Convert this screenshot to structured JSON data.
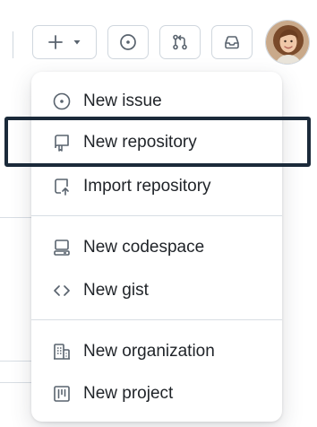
{
  "header": {
    "create_button_icon": "plus-icon",
    "create_dropdown_icon": "triangle-down-icon",
    "issues_icon": "issue-opened-icon",
    "pull_requests_icon": "git-pull-request-icon",
    "inbox_icon": "inbox-icon"
  },
  "menu": {
    "items": [
      {
        "label": "New issue",
        "icon": "issue-opened-icon"
      },
      {
        "label": "New repository",
        "icon": "repo-icon"
      },
      {
        "label": "Import repository",
        "icon": "repo-push-icon"
      },
      {
        "label": "New codespace",
        "icon": "codespaces-icon"
      },
      {
        "label": "New gist",
        "icon": "code-icon"
      },
      {
        "label": "New organization",
        "icon": "organization-icon"
      },
      {
        "label": "New project",
        "icon": "project-icon"
      }
    ]
  },
  "colors": {
    "highlight_border": "#1b2a3a",
    "icon": "#59636e",
    "border": "#d0d7de"
  }
}
